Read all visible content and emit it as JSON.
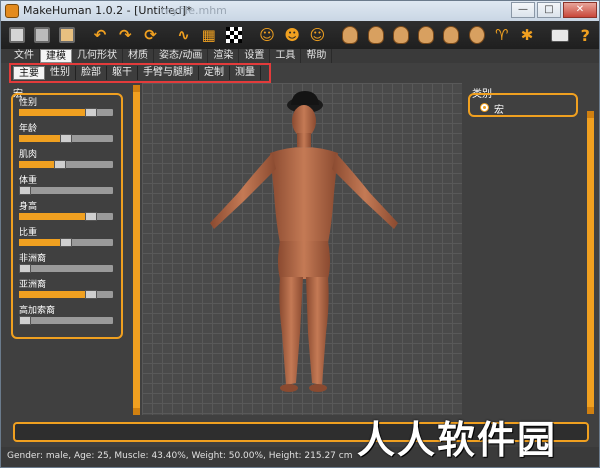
{
  "window": {
    "title": "MakeHuman 1.0.2 - [Untitled]*",
    "ghost_title": "myfile.mhm",
    "controls": [
      "—",
      "□",
      "✕"
    ]
  },
  "toolbar": {
    "icons": [
      "save-disk-icon",
      "load-icon",
      "export-icon",
      "undo-icon",
      "redo-icon",
      "reset-icon",
      "wireframe-icon",
      "grid-icon",
      "checker-icon",
      "front-view-icon",
      "back-view-icon",
      "side-view-icon",
      "face-icon",
      "face-left-icon",
      "face-right-icon",
      "head-top-icon",
      "head-bottom-icon",
      "expression-icon",
      "pose-icon",
      "symmetry-icon",
      "camera-icon",
      "help-icon"
    ],
    "help_label": "?"
  },
  "main_tabs": [
    "文件",
    "建模",
    "几何形状",
    "材质",
    "姿态/动画",
    "渲染",
    "设置",
    "工具",
    "帮助"
  ],
  "main_tab_active": 1,
  "sub_tabs": [
    "主要",
    "性别",
    "脸部",
    "躯干",
    "手臂与腿脚",
    "定制",
    "测量"
  ],
  "sub_tab_active": 0,
  "left_panel": {
    "title": "宏",
    "sliders": [
      {
        "label": "性别",
        "value": 0.8
      },
      {
        "label": "年龄",
        "value": 0.5
      },
      {
        "label": "肌肉",
        "value": 0.43
      },
      {
        "label": "体重",
        "value": 0.0
      },
      {
        "label": "身高",
        "value": 0.8
      },
      {
        "label": "比重",
        "value": 0.5
      },
      {
        "label": "非洲裔",
        "value": 0.0
      },
      {
        "label": "亚洲裔",
        "value": 0.8
      },
      {
        "label": "高加索裔",
        "value": 0.0
      }
    ]
  },
  "right_panel": {
    "title": "类别",
    "option": "宏"
  },
  "status": "Gender: male, Age: 25, Muscle: 43.40%, Weight: 50.00%, Height: 215.27 cm",
  "watermark": "人人软件园",
  "colors": {
    "accent": "#f0a020",
    "skin": "#b86a48",
    "hat": "#1a1a1a"
  }
}
